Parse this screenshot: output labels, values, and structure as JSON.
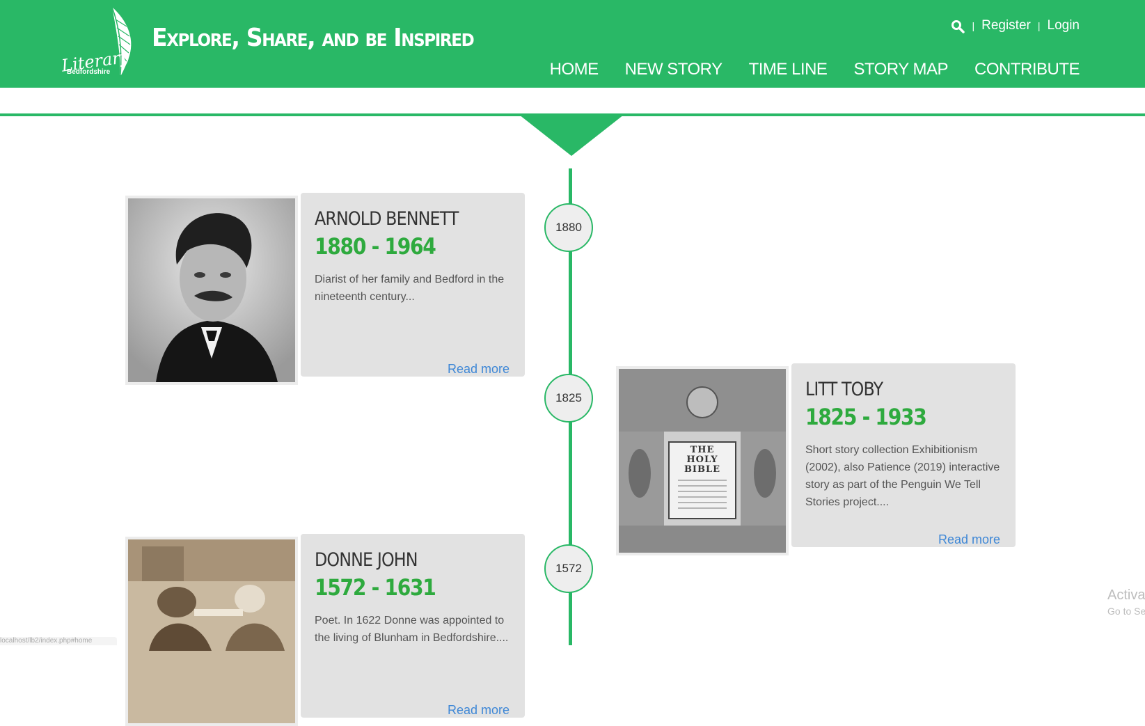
{
  "header": {
    "logo": {
      "script_text": "Literary",
      "sub_text": "Bedfordshire"
    },
    "tagline": "Explore, Share, and be Inspired",
    "top_links": {
      "separator": "|",
      "register": "Register",
      "login": "Login"
    },
    "nav": [
      {
        "label": "HOME"
      },
      {
        "label": "NEW STORY"
      },
      {
        "label": "TIME LINE"
      },
      {
        "label": "STORY MAP"
      },
      {
        "label": "CONTRIBUTE"
      }
    ],
    "accent_color": "#29b866"
  },
  "timeline": {
    "years": [
      "1880",
      "1825",
      "1572"
    ],
    "stories": [
      {
        "name": "ARNOLD BENNETT",
        "years": "1880 - 1964",
        "description": "Diarist of her family and Bedford in the nineteenth century...",
        "read_more": "Read more",
        "image": "portrait-photo"
      },
      {
        "name": "LITT TOBY",
        "years": "1825 - 1933",
        "description": "Short story collection Exhibitionism (2002), also Patience (2019) interactive story as part of the Penguin We Tell Stories project....",
        "read_more": "Read more",
        "image": "bible-title-page",
        "image_text": "THE HOLY BIBLE"
      },
      {
        "name": "DONNE JOHN",
        "years": "1572 - 1631",
        "description": "Poet. In 1622 Donne was appointed to the living of Blunham in Bedfordshire....",
        "read_more": "Read more",
        "image": "sepia-engraving"
      }
    ]
  },
  "overlay": {
    "activate_title": "Activa",
    "activate_sub": "Go to Se",
    "status_url": "localhost/lb2/index.php#home"
  }
}
